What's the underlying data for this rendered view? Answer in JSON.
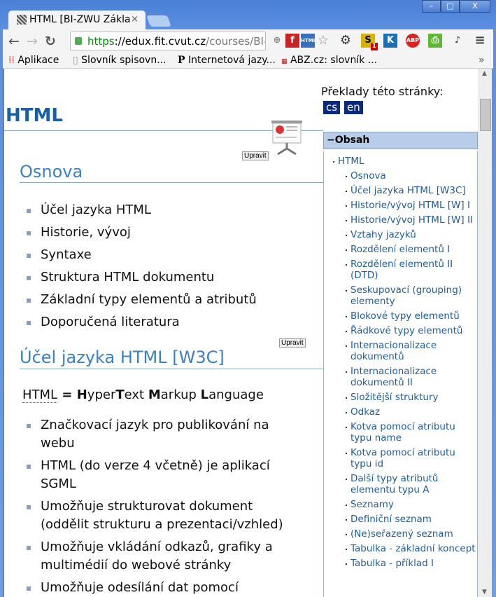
{
  "browser": {
    "tab_title": "HTML [BI-ZWU Zákla",
    "url_scheme": "https",
    "url_host": "://edux.fit.cvut.cz",
    "url_path": "/courses/BI-ZWU",
    "window_buttons": [
      "–",
      "□",
      "X"
    ]
  },
  "bookmarks": [
    "Aplikace",
    "Slovník spisovn...",
    "Internetová jazy...",
    "ABZ.cz: slovník ..."
  ],
  "extensions": {
    "s_badge": "1",
    "k": "K",
    "abp": "ABP"
  },
  "page": {
    "title": "HTML",
    "translations_label": "Překlady této stránky:",
    "languages": [
      "cs",
      "en"
    ],
    "edit_label": "Upravit",
    "sections": [
      {
        "heading": "Osnova",
        "items": [
          "Účel jazyka HTML",
          "Historie, vývoj",
          "Syntaxe",
          "Struktura HTML dokumentu",
          "Základní typy elementů a atributů",
          "Doporučená literatura"
        ]
      },
      {
        "heading": "Účel jazyka HTML [W3C]",
        "definition": {
          "abbr": "HTML",
          "eq": " = ",
          "H": "H",
          "yper": "yper",
          "T": "T",
          "ext": "ext ",
          "M": "M",
          "arkup": "arkup ",
          "L": "L",
          "anguage": "anguage"
        },
        "items": [
          "Značkovací jazyk pro publikování na webu",
          "HTML (do verze 4 včetně) je aplikací SGML",
          "Umožňuje strukturovat dokument (oddělit strukturu a prezentaci/vzhled)",
          "Umožňuje vkládání odkazů, grafiky a multimédií do webové stránky",
          "Umožňuje odesílání dat pomocí formulářů"
        ]
      }
    ]
  },
  "toc": {
    "header": "−Obsah",
    "root": "HTML",
    "items": [
      "Osnova",
      "Účel jazyka HTML [W3C]",
      "Historie/vývoj HTML [W] I",
      "Historie/vývoj HTML [W] II",
      "Vztahy jazyků",
      "Rozdělení elementů I",
      "Rozdělení elementů II (DTD)",
      "Seskupovací (grouping) elementy",
      "Blokové typy elementů",
      "Řádkové typy elementů",
      "Internacionalizace dokumentů",
      "Internacionalizace dokumentů II",
      "Složitější struktury",
      "Odkaz",
      "Kotva pomocí atributu typu name",
      "Kotva pomocí atributu typu id",
      "Další typy atributů elementu typu A",
      "Seznamy",
      "Definiční seznam",
      "(Ne)seřazený seznam",
      "Tabulka - základní koncept",
      "Tabulka - příklad I"
    ]
  }
}
